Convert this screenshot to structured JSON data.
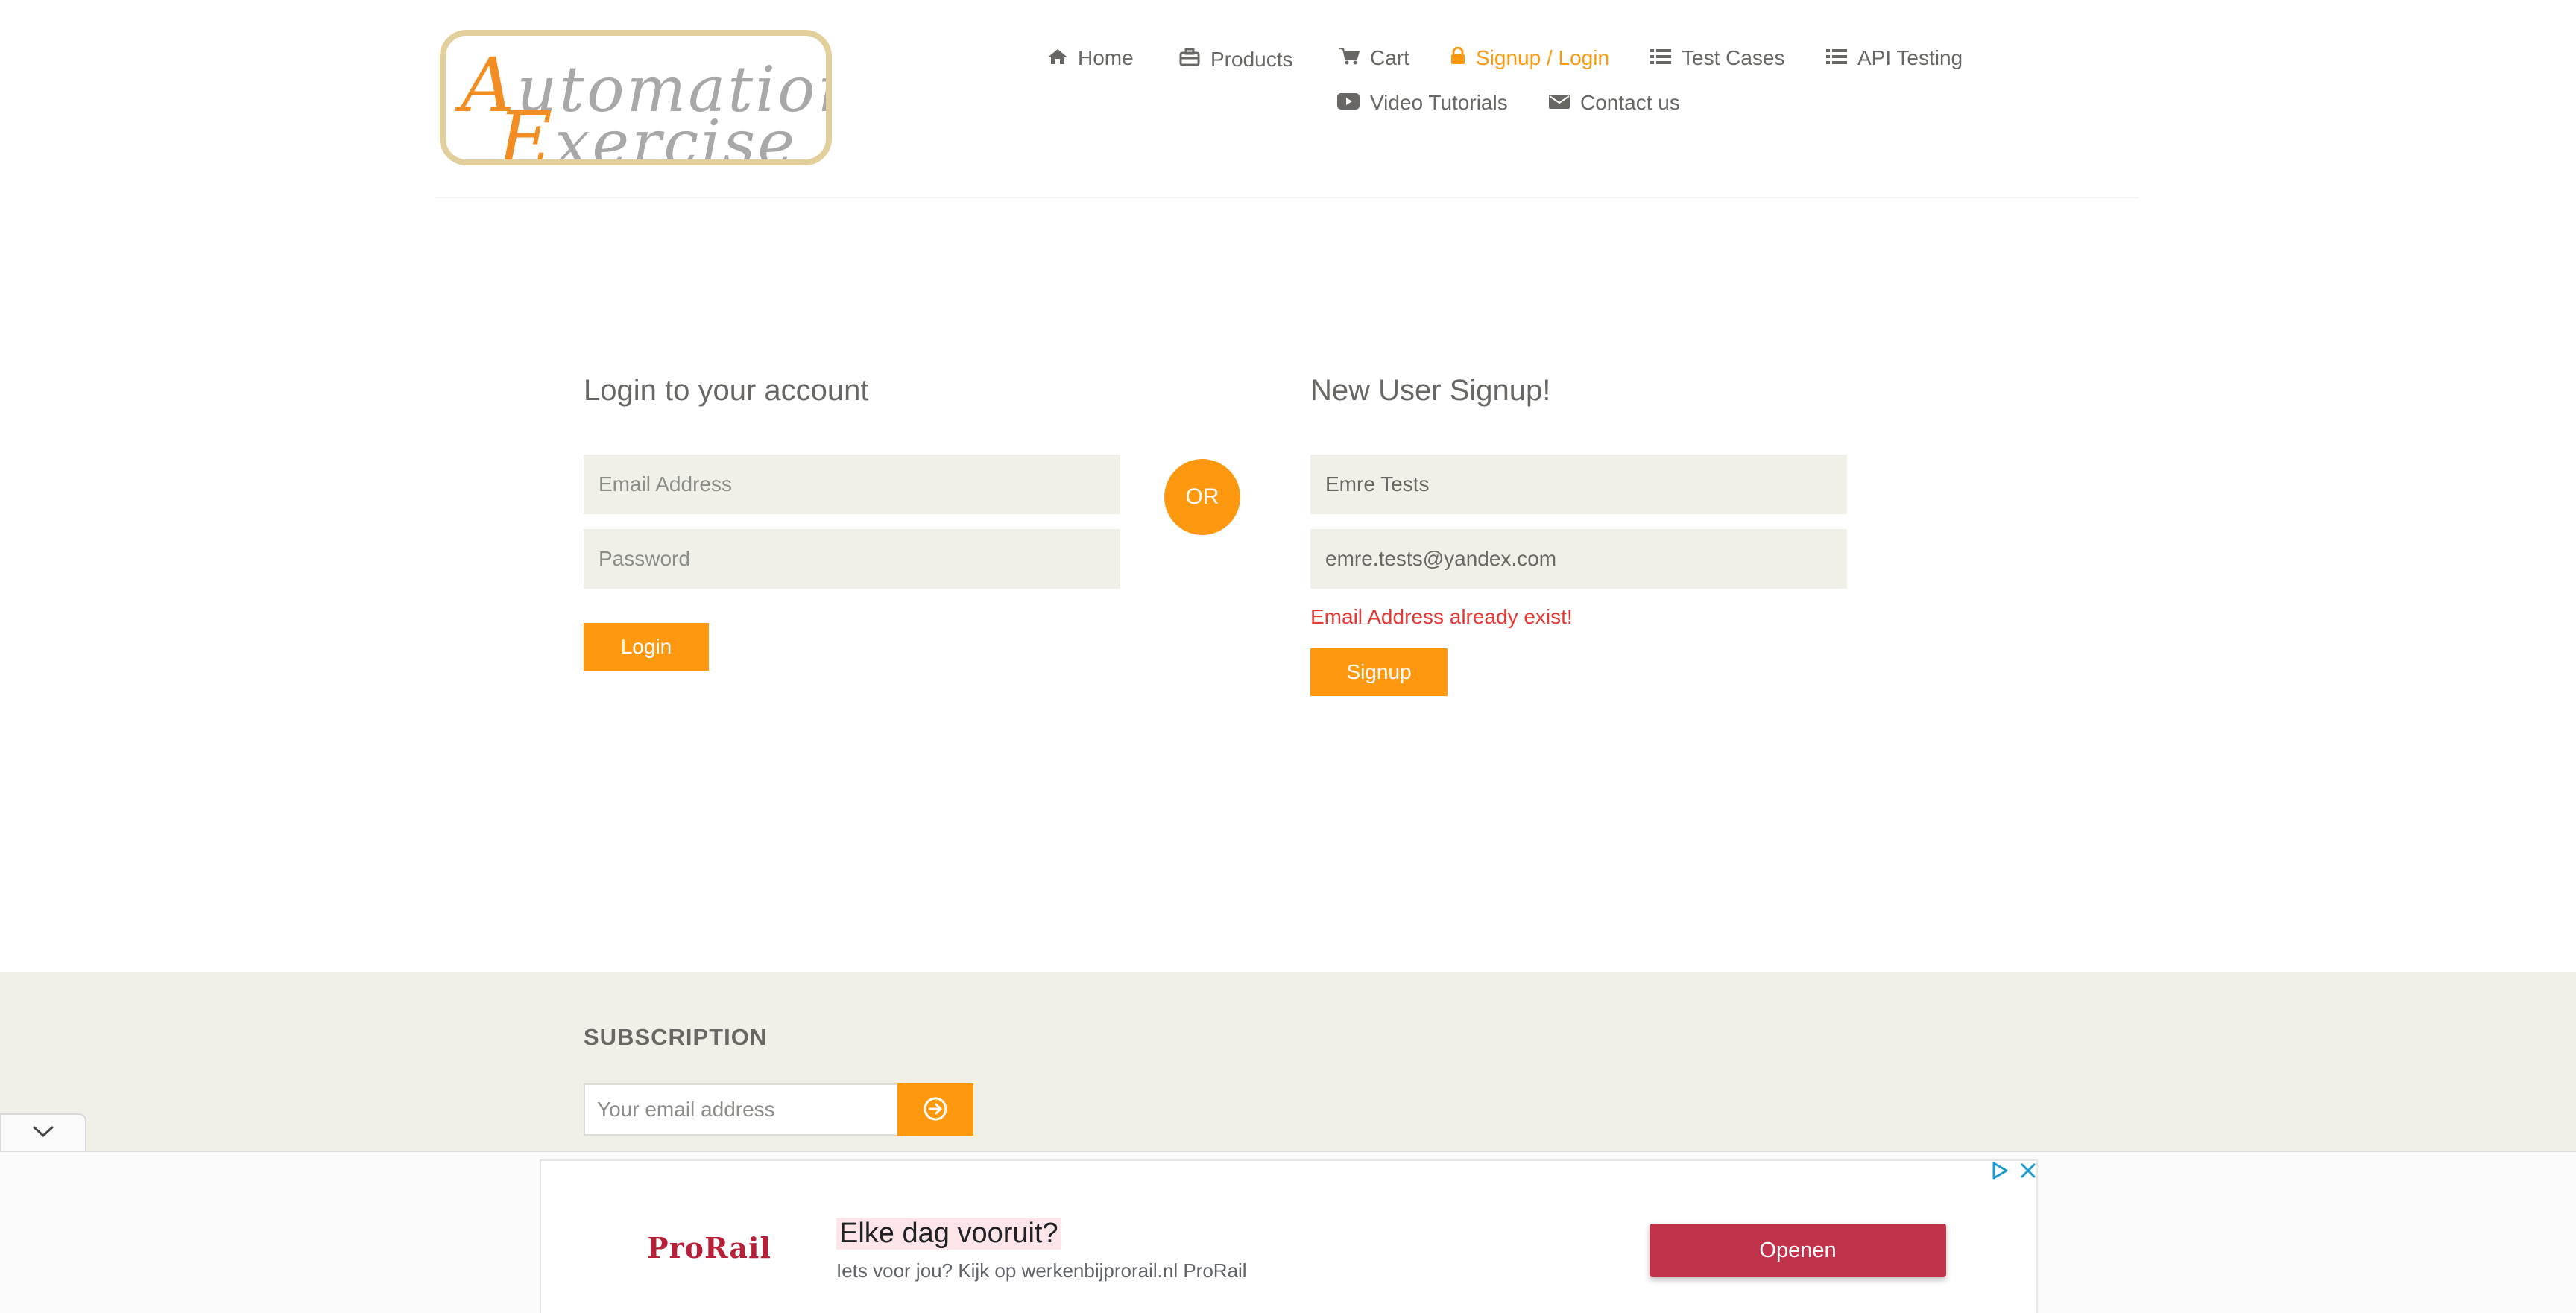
{
  "header": {
    "logo": {
      "line1_cap": "A",
      "line1_rest": "utomation",
      "line2_cap": "E",
      "line2_rest": "xercise"
    },
    "nav": [
      {
        "label": "Home",
        "icon": "home-icon"
      },
      {
        "label": "Products",
        "icon": "briefcase-icon"
      },
      {
        "label": "Cart",
        "icon": "cart-icon"
      },
      {
        "label": "Signup / Login",
        "icon": "lock-icon",
        "active": true
      },
      {
        "label": "Test Cases",
        "icon": "list-icon"
      },
      {
        "label": "API Testing",
        "icon": "list-icon"
      },
      {
        "label": "Video Tutorials",
        "icon": "youtube-icon"
      },
      {
        "label": "Contact us",
        "icon": "envelope-icon"
      }
    ]
  },
  "login": {
    "title": "Login to your account",
    "email_placeholder": "Email Address",
    "password_placeholder": "Password",
    "button": "Login"
  },
  "or_label": "OR",
  "signup": {
    "title": "New User Signup!",
    "name_value": "Emre Tests",
    "email_value": "emre.tests@yandex.com",
    "error": "Email Address already exist!",
    "button": "Signup"
  },
  "footer": {
    "subscription_title": "SUBSCRIPTION",
    "email_placeholder": "Your email address"
  },
  "ad": {
    "brand": "ProRail",
    "headline": "Elke dag vooruit?",
    "description": "Iets voor jou? Kijk op werkenbijprorail.nl ProRail",
    "cta": "Openen"
  },
  "colors": {
    "accent": "#FE980F",
    "error": "#e53935",
    "ad_cta": "#c0314a",
    "field_bg": "#F0F0E9"
  }
}
